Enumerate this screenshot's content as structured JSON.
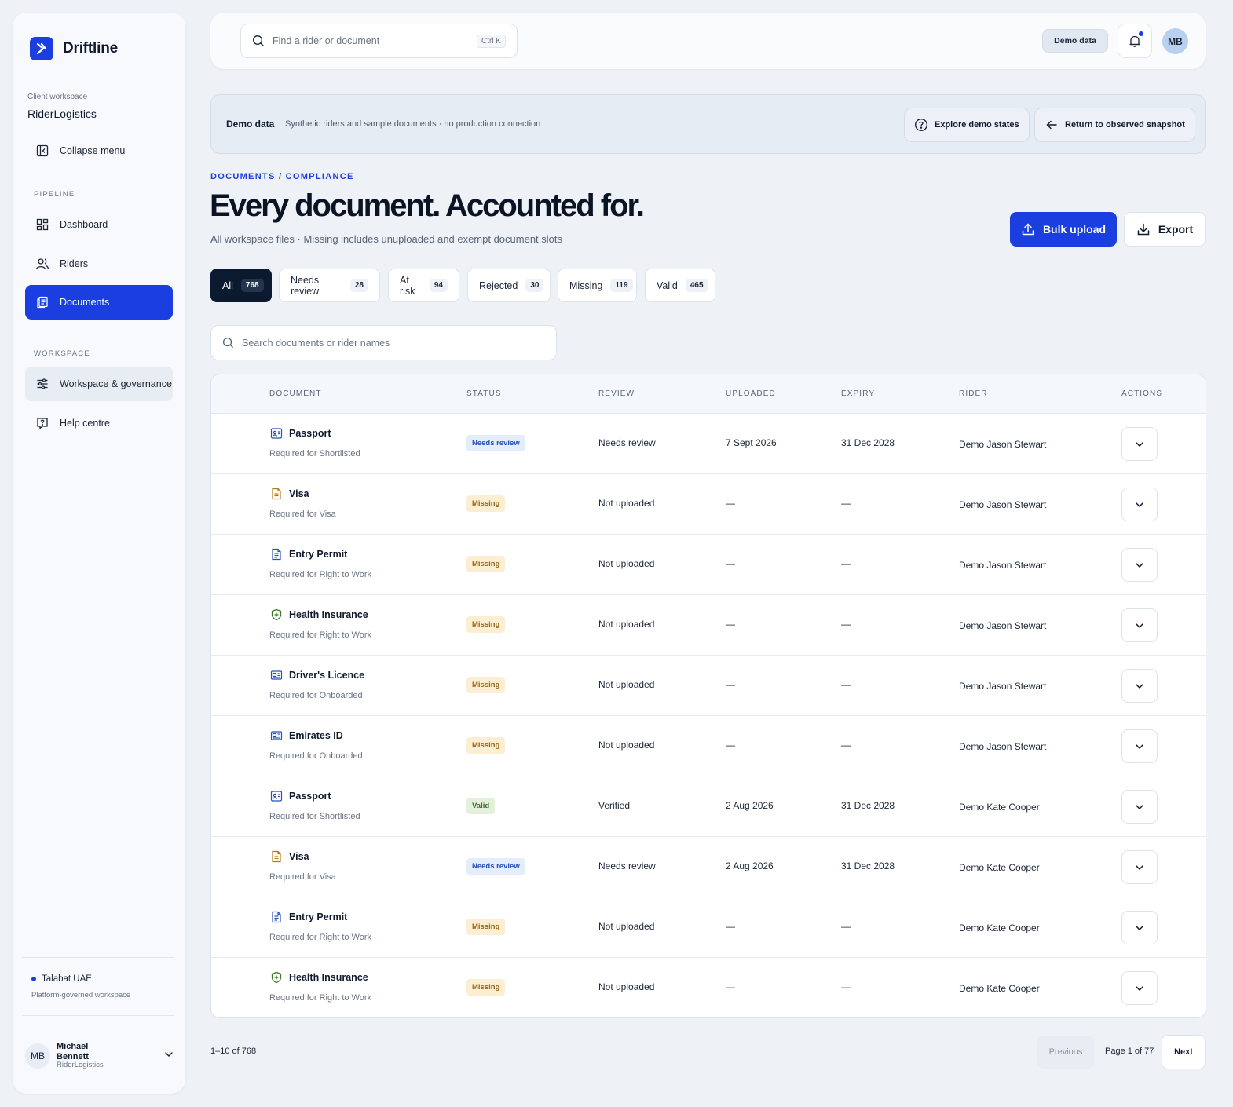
{
  "brand": {
    "name": "Driftline"
  },
  "workspace": {
    "label": "Client workspace",
    "name": "RiderLogistics"
  },
  "sidebar": {
    "collapse_label": "Collapse menu",
    "pipeline_label": "PIPELINE",
    "pipeline_items": [
      {
        "label": "Dashboard",
        "icon": "dashboard-icon"
      },
      {
        "label": "Riders",
        "icon": "users-icon"
      },
      {
        "label": "Documents",
        "icon": "documents-icon",
        "active": true
      }
    ],
    "workspace_label": "WORKSPACE",
    "workspace_items": [
      {
        "label": "Workspace & governance",
        "icon": "sliders-icon"
      },
      {
        "label": "Help centre",
        "icon": "help-icon"
      }
    ],
    "org": {
      "name": "Talabat UAE",
      "sub": "Platform-governed workspace"
    },
    "user": {
      "initials": "MB",
      "name": "Michael Bennett",
      "org": "RiderLogistics"
    }
  },
  "topbar": {
    "search_placeholder": "Find a rider or document",
    "shortcut": "Ctrl K",
    "demo_chip": "Demo data",
    "avatar_initials": "MB"
  },
  "banner": {
    "title": "Demo data",
    "description": "Synthetic riders and sample documents · no production connection",
    "explore_label": "Explore demo states",
    "return_label": "Return to observed snapshot"
  },
  "header": {
    "breadcrumb": "DOCUMENTS / COMPLIANCE",
    "title": "Every document. Accounted for.",
    "subtitle": "All workspace files · Missing includes unuploaded and exempt document slots",
    "bulk_upload_label": "Bulk upload",
    "export_label": "Export"
  },
  "filters": [
    {
      "label": "All",
      "count": "768",
      "active": true
    },
    {
      "label": "Needs review",
      "count": "28"
    },
    {
      "label": "At risk",
      "count": "94"
    },
    {
      "label": "Rejected",
      "count": "30"
    },
    {
      "label": "Missing",
      "count": "119"
    },
    {
      "label": "Valid",
      "count": "465"
    }
  ],
  "table_search": {
    "placeholder": "Search documents or rider names"
  },
  "table": {
    "columns": [
      "DOCUMENT",
      "STATUS",
      "REVIEW",
      "UPLOADED",
      "EXPIRY",
      "RIDER",
      "ACTIONS"
    ],
    "rows": [
      {
        "icon": "id-card-icon",
        "name": "Passport",
        "requirement": "Required for Shortlisted",
        "status": "Needs review",
        "review": "Needs review",
        "uploaded": "7 Sept 2026",
        "expiry": "31 Dec 2028",
        "rider": "Demo Jason Stewart"
      },
      {
        "icon": "file-icon",
        "name": "Visa",
        "requirement": "Required for Visa",
        "status": "Missing",
        "review": "Not uploaded",
        "uploaded": "—",
        "expiry": "—",
        "rider": "Demo Jason Stewart"
      },
      {
        "icon": "document-icon",
        "name": "Entry Permit",
        "requirement": "Required for Right to Work",
        "status": "Missing",
        "review": "Not uploaded",
        "uploaded": "—",
        "expiry": "—",
        "rider": "Demo Jason Stewart"
      },
      {
        "icon": "shield-icon",
        "name": "Health Insurance",
        "requirement": "Required for Right to Work",
        "status": "Missing",
        "review": "Not uploaded",
        "uploaded": "—",
        "expiry": "—",
        "rider": "Demo Jason Stewart"
      },
      {
        "icon": "license-icon",
        "name": "Driver's Licence",
        "requirement": "Required for Onboarded",
        "status": "Missing",
        "review": "Not uploaded",
        "uploaded": "—",
        "expiry": "—",
        "rider": "Demo Jason Stewart"
      },
      {
        "icon": "license-icon",
        "name": "Emirates ID",
        "requirement": "Required for Onboarded",
        "status": "Missing",
        "review": "Not uploaded",
        "uploaded": "—",
        "expiry": "—",
        "rider": "Demo Jason Stewart"
      },
      {
        "icon": "id-card-icon",
        "name": "Passport",
        "requirement": "Required for Shortlisted",
        "status": "Valid",
        "review": "Verified",
        "uploaded": "2 Aug 2026",
        "expiry": "31 Dec 2028",
        "rider": "Demo Kate Cooper"
      },
      {
        "icon": "file-icon",
        "name": "Visa",
        "requirement": "Required for Visa",
        "status": "Needs review",
        "review": "Needs review",
        "uploaded": "2 Aug 2026",
        "expiry": "31 Dec 2028",
        "rider": "Demo Kate Cooper"
      },
      {
        "icon": "document-icon",
        "name": "Entry Permit",
        "requirement": "Required for Right to Work",
        "status": "Missing",
        "review": "Not uploaded",
        "uploaded": "—",
        "expiry": "—",
        "rider": "Demo Kate Cooper"
      },
      {
        "icon": "shield-icon",
        "name": "Health Insurance",
        "requirement": "Required for Right to Work",
        "status": "Missing",
        "review": "Not uploaded",
        "uploaded": "—",
        "expiry": "—",
        "rider": "Demo Kate Cooper"
      }
    ]
  },
  "pagination": {
    "range": "1–10 of 768",
    "previous": "Previous",
    "page_info": "Page 1 of 77",
    "next": "Next"
  },
  "colors": {
    "accent": "#1a3ee0",
    "needs_review_bg": "#e4edfb",
    "needs_review_fg": "#2650b8",
    "missing_bg": "#fbeed3",
    "missing_fg": "#9a6612",
    "valid_bg": "#e3f1dc",
    "valid_fg": "#3c6e28"
  }
}
